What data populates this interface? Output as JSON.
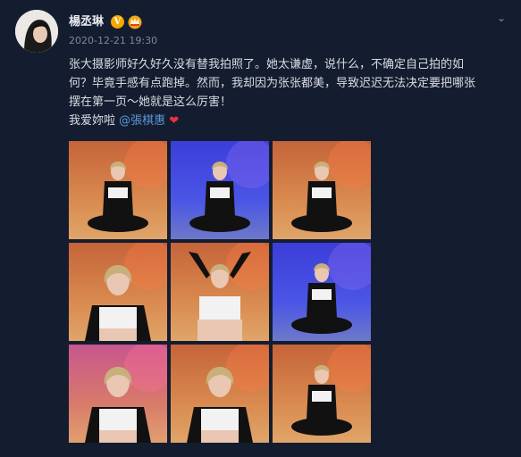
{
  "post": {
    "username": "楊丞琳",
    "verified_badge": "V",
    "member_icon": "crown-icon",
    "timestamp": "2020-12-21 19:30",
    "text_lines": [
      "张大摄影师好久好久没有替我拍照了。她太谦虚，说什么，不确定自己拍的如",
      "何？毕竟手感有点跑掉。然而，我却因为张张都美，导致迟迟无法决定要把哪张",
      "摆在第一页～她就是这么厉害！"
    ],
    "love_text": "我爱妳啦 ",
    "mention": "@張棋惠",
    "heart": "❤"
  },
  "colors": {
    "background": "#141d2f",
    "link": "#5a97d8",
    "badge": "#f6a800",
    "heart": "#e8323f"
  },
  "photos": [
    {
      "scene": "warm",
      "pose": "sit-front"
    },
    {
      "scene": "blue",
      "pose": "sit-side"
    },
    {
      "scene": "warm",
      "pose": "sit-front"
    },
    {
      "scene": "warm",
      "pose": "half-side"
    },
    {
      "scene": "warm",
      "pose": "arms-up"
    },
    {
      "scene": "blue",
      "pose": "sit-front"
    },
    {
      "scene": "pink",
      "pose": "half-close"
    },
    {
      "scene": "warm",
      "pose": "half-close"
    },
    {
      "scene": "warm",
      "pose": "sit-front"
    }
  ]
}
